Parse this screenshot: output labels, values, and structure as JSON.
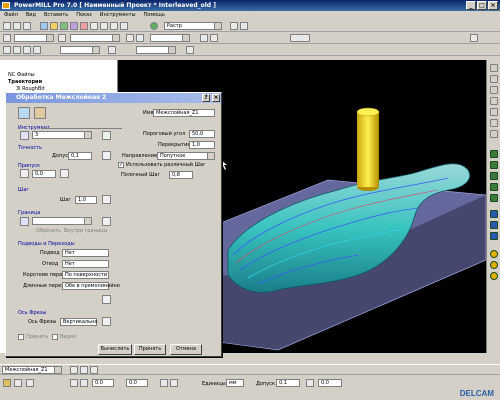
{
  "app": {
    "title": "PowerMILL Pro 7.0    [ Наименный Проект * Interleaved_old ]"
  },
  "window_buttons": [
    "_",
    "□",
    "×"
  ],
  "menu": [
    "Файл",
    "Вид",
    "Вставить",
    "Показ",
    "Инструменты",
    "Помощь"
  ],
  "toolbar": {
    "strategy_combo": "Растр"
  },
  "tree": {
    "items": [
      "NC Файлы",
      "Траектории",
      "3l RoughBit"
    ]
  },
  "dialog": {
    "title": "Обработка Межслойная 2",
    "help_btn": "?",
    "close_btn": "×",
    "name_label": "Имя",
    "name_value": "Межслойная_Z1",
    "tool_group": "Инструмент",
    "tool_value": "3",
    "tolerance_group": "Точность",
    "tolerance_label": "Допуск",
    "tolerance_value": "0,1",
    "allowance_group": "Припуск",
    "allowance_value": "0,0",
    "threshold_angle_label": "Пороговый угол",
    "threshold_angle_value": "50,0",
    "overlap_label": "Перекрытие",
    "overlap_value": "1,0",
    "direction_label": "Направление",
    "direction_value": "Попутное",
    "use_step_label": "Использовать различный Шаг",
    "full_step_label": "Полочный Шаг",
    "full_step_value": "0,8",
    "step_group": "Шаг",
    "step_label": "Шаг",
    "step_value": "1,0",
    "boundary_group": "Граница",
    "boundary_action": "Обрезать",
    "boundary_action2": "Внутри границы",
    "leads_group": "Подводы и Переходы",
    "lead_in_label": "Подвод",
    "lead_in_value": "Нет",
    "lead_out_label": "Отвод",
    "lead_out_value": "Нет",
    "short_link_label": "Короткие перех.",
    "short_link_value": "По поверхности",
    "long_link_label": "Длинные перех.",
    "long_link_value": "Обе в прямолинейно",
    "axis_group": "Ось Фрезы",
    "axis_label": "Ось Фрезы",
    "axis_value": "Вертикально",
    "apply_check_label": "Принять",
    "preview_check_label": "Видно",
    "calc_btn": "Вычислить",
    "accept_btn": "Принять",
    "cancel_btn": "Отмена"
  },
  "status": {
    "toolpath_combo": "Межслойная_Z1"
  },
  "bottombar": {
    "val1": "0,0",
    "val2": "0,0",
    "units_label": "Единицы",
    "units_value": "мм",
    "tolerance_label": "Допуск",
    "tolerance_value": "0,1",
    "allowance_value": "0,0",
    "logo": "DELCAM"
  },
  "colors": {
    "title_bar": "#0a246a",
    "viewport_bg": "#000000",
    "part_cyan": "#38c4c0",
    "tool_yellow": "#e8d020",
    "toolpath_blue": "#3a5cf0",
    "stock_violet": "#7d82c8"
  }
}
